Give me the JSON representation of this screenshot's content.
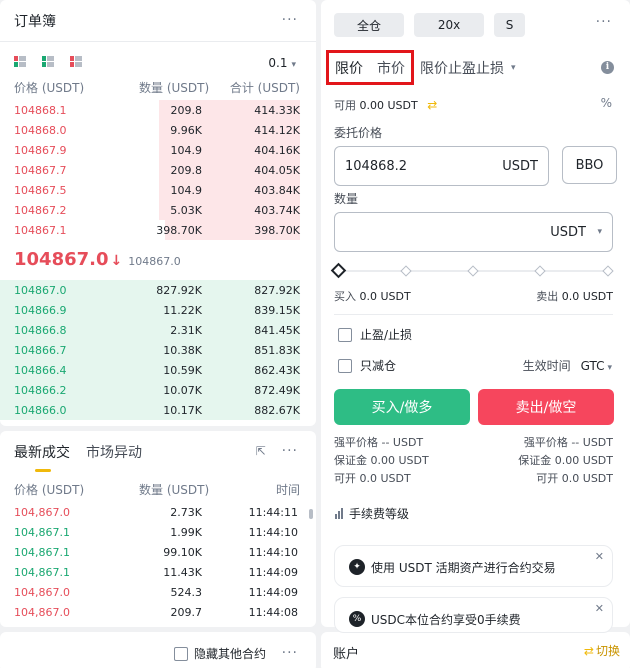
{
  "orderbook": {
    "title": "订单簿",
    "more": "···",
    "precision": "0.1",
    "precision_arrow": "▾",
    "cols": {
      "price": "价格 (USDT)",
      "qty": "数量 (USDT)",
      "total": "合计 (USDT)"
    },
    "asks": [
      {
        "price": "104868.1",
        "qty": "209.8",
        "total": "414.33K",
        "depth": 0.47
      },
      {
        "price": "104868.0",
        "qty": "9.96K",
        "total": "414.12K",
        "depth": 0.47
      },
      {
        "price": "104867.9",
        "qty": "104.9",
        "total": "404.16K",
        "depth": 0.47
      },
      {
        "price": "104867.7",
        "qty": "209.8",
        "total": "404.05K",
        "depth": 0.47
      },
      {
        "price": "104867.5",
        "qty": "104.9",
        "total": "403.84K",
        "depth": 0.47
      },
      {
        "price": "104867.2",
        "qty": "5.03K",
        "total": "403.74K",
        "depth": 0.47
      },
      {
        "price": "104867.1",
        "qty": "398.70K",
        "total": "398.70K",
        "depth": 0.45
      }
    ],
    "mid": {
      "price": "104867.0",
      "arrow": "↓",
      "mark": "104867.0"
    },
    "bids": [
      {
        "price": "104867.0",
        "qty": "827.92K",
        "total": "827.92K",
        "depth": 1.0
      },
      {
        "price": "104866.9",
        "qty": "11.22K",
        "total": "839.15K",
        "depth": 1.0
      },
      {
        "price": "104866.8",
        "qty": "2.31K",
        "total": "841.45K",
        "depth": 1.0
      },
      {
        "price": "104866.7",
        "qty": "10.38K",
        "total": "851.83K",
        "depth": 1.0
      },
      {
        "price": "104866.4",
        "qty": "10.59K",
        "total": "862.43K",
        "depth": 1.0
      },
      {
        "price": "104866.2",
        "qty": "10.07K",
        "total": "872.49K",
        "depth": 1.0
      },
      {
        "price": "104866.0",
        "qty": "10.17K",
        "total": "882.67K",
        "depth": 1.0
      }
    ]
  },
  "trades": {
    "tabs": [
      "最新成交",
      "市场异动"
    ],
    "popout": "⇱",
    "more": "···",
    "cols": {
      "price": "价格 (USDT)",
      "qty": "数量 (USDT)",
      "time": "时间"
    },
    "rows": [
      {
        "price": "104,867.0",
        "qty": "2.73K",
        "time": "11:44:11",
        "side": "sell"
      },
      {
        "price": "104,867.1",
        "qty": "1.99K",
        "time": "11:44:10",
        "side": "buy"
      },
      {
        "price": "104,867.1",
        "qty": "99.10K",
        "time": "11:44:10",
        "side": "buy"
      },
      {
        "price": "104,867.1",
        "qty": "11.43K",
        "time": "11:44:09",
        "side": "buy"
      },
      {
        "price": "104,867.0",
        "qty": "524.3",
        "time": "11:44:09",
        "side": "sell"
      },
      {
        "price": "104,867.0",
        "qty": "209.7",
        "time": "11:44:08",
        "side": "sell"
      }
    ]
  },
  "positions": {
    "hide_other": "隐藏其他合约",
    "more": "···"
  },
  "account": {
    "title": "账户",
    "switch_label": "切换",
    "switch_icon": "⇄"
  },
  "form": {
    "margin_mode": "全仓",
    "leverage": "20x",
    "asset_mode": "S",
    "more": "···",
    "order_types": [
      "限价",
      "市价",
      "限价止盈止损"
    ],
    "order_type_arrow": "▾",
    "info_icon": "i",
    "avail_label": "可用",
    "avail_value": "0.00 USDT",
    "transfer_icon": "⇄",
    "calc_icon": "%",
    "price_label": "委托价格",
    "price_value": "104868.2",
    "price_unit": "USDT",
    "bbo": "BBO",
    "qty_label": "数量",
    "qty_unit": "USDT",
    "qty_arrow": "▾",
    "slider_percent": 0,
    "buy_label": "买入",
    "buy_value": "0.0 USDT",
    "sell_label": "卖出",
    "sell_value": "0.0 USDT",
    "tpsl": "止盈/止损",
    "reduce_only": "只减仓",
    "tif_label": "生效时间",
    "tif_value": "GTC",
    "tif_arrow": "▾",
    "buy_button": "买入/做多",
    "sell_button": "卖出/做空",
    "info_rows": [
      {
        "l": "强平价格 -- USDT",
        "r": "强平价格 -- USDT"
      },
      {
        "l": "保证金 0.00 USDT",
        "r": "保证金 0.00 USDT"
      },
      {
        "l": "可开 0.0 USDT",
        "r": "可开 0.0 USDT"
      }
    ],
    "fee_level": "手续费等级",
    "banners": [
      {
        "text": "使用 USDT 活期资产进行合约交易",
        "icon": "✦",
        "close": "✕"
      },
      {
        "text": "USDC本位合约享受0手续费",
        "icon": "%",
        "close": "✕"
      }
    ]
  },
  "colors": {
    "up": "#1aa872",
    "down": "#e64d5a",
    "buy_button": "#2ebd85",
    "sell_button": "#f6465d",
    "accent": "#f0b90b"
  }
}
